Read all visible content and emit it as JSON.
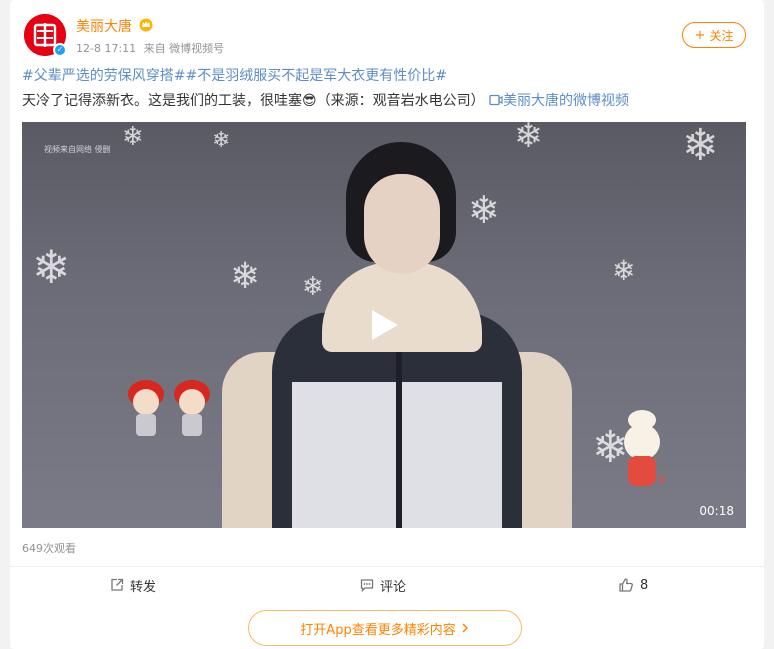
{
  "post": {
    "username": "美丽大唐",
    "avatar_char": "唐",
    "date": "12-8 17:11",
    "source": "来自 微博视频号",
    "follow_label": "关注",
    "hashtags": "#父辈严选的劳保风穿搭##不是羽绒服买不起是军大衣更有性价比#",
    "text": "天冷了记得添新衣。这是我们的工装，很哇塞",
    "emoji": "😎",
    "text_source": "（来源：观音岩水电公司）",
    "video_link_label": "美丽大唐的微博视频",
    "video": {
      "watermark": "视频来自网络 侵删",
      "duration": "00:18"
    },
    "views": "649次观看",
    "actions": {
      "repost_label": "转发",
      "comment_label": "评论",
      "like_count": "8"
    },
    "open_app_label": "打开App查看更多精彩内容"
  },
  "colors": {
    "accent": "#ff8200",
    "link": "#5d8dc6",
    "brand_red": "#e60012"
  },
  "icons": {
    "verify": "verified-badge-icon",
    "crown": "crown-icon",
    "play": "play-icon",
    "repost": "repost-icon",
    "comment": "comment-icon",
    "like": "thumbs-up-icon",
    "video_link": "video-link-icon",
    "chevron": "chevron-right-icon"
  }
}
